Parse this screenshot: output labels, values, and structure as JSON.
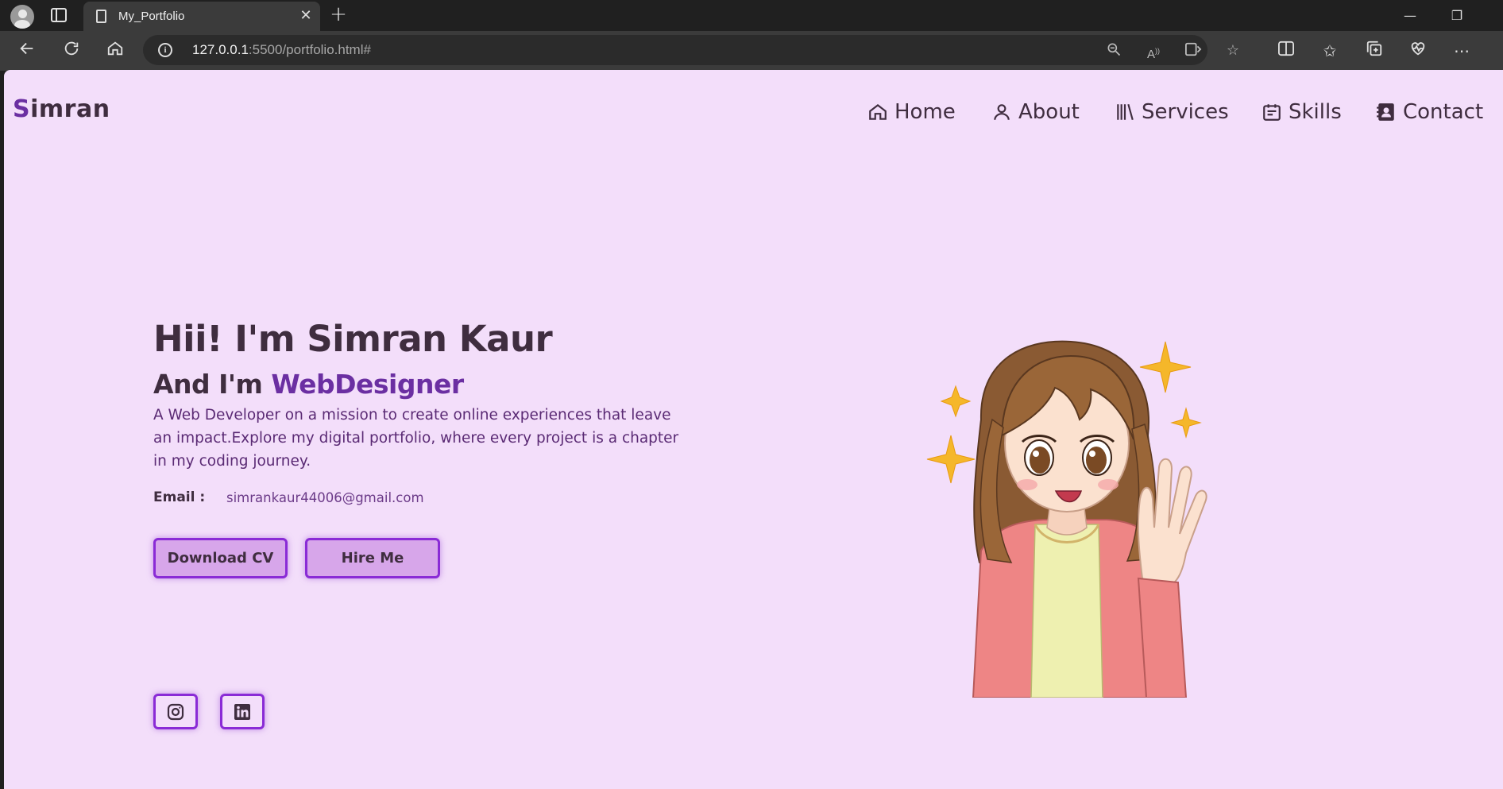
{
  "browser": {
    "tab_title": "My_Portfolio",
    "url_host": "127.0.0.1",
    "url_rest": ":5500/portfolio.html#",
    "icons": [
      "profile-icon",
      "tab-actions-icon",
      "document-icon",
      "close-icon",
      "new-tab-icon",
      "minimize-icon",
      "restore-icon",
      "back-icon",
      "refresh-icon",
      "home-icon",
      "info-icon",
      "zoom-out-icon",
      "read-aloud-icon",
      "immersive-reader-icon",
      "favorite-star-icon",
      "split-screen-icon",
      "favorites-icon",
      "collections-icon",
      "browser-essentials-icon",
      "more-icon"
    ]
  },
  "page": {
    "logo_first": "S",
    "logo_rest": "imran",
    "nav": [
      {
        "label": "Home",
        "icon": "home-icon"
      },
      {
        "label": "About",
        "icon": "user-icon"
      },
      {
        "label": "Services",
        "icon": "library-icon"
      },
      {
        "label": "Skills",
        "icon": "calendar-icon"
      },
      {
        "label": "Contact",
        "icon": "contact-card-icon"
      }
    ],
    "hero": {
      "title": "Hii! I'm Simran Kaur",
      "sub_prefix": "And I'm ",
      "role": "WebDesigner",
      "description": "A Web Developer on a mission to create online experiences that leave an impact.Explore my digital portfolio, where every project is a chapter in my coding journey.",
      "email_label": "Email :",
      "email": "simrankaur44006@gmail.com",
      "download_label": "Download CV",
      "hire_label": "Hire Me"
    },
    "social": [
      {
        "name": "instagram-icon"
      },
      {
        "name": "linkedin-icon"
      }
    ],
    "colors": {
      "background": "#f3defa",
      "text": "#3f2d3f",
      "accent": "#6b2fa2",
      "button_bg": "#d7a6ea",
      "button_border": "#8a2bd6"
    }
  }
}
